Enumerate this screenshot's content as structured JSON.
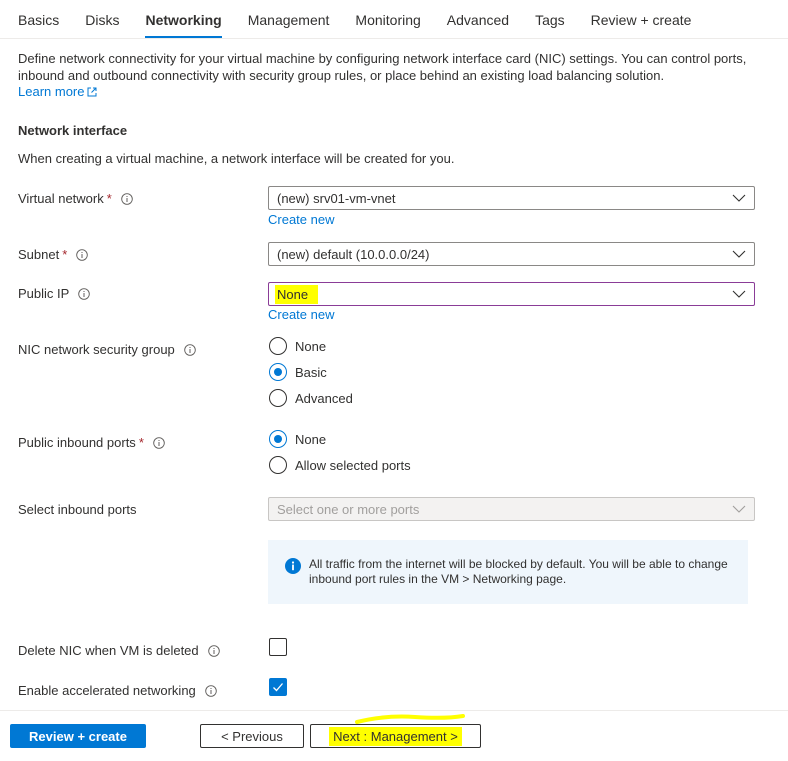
{
  "tabs": [
    {
      "label": "Basics"
    },
    {
      "label": "Disks"
    },
    {
      "label": "Networking",
      "active": true
    },
    {
      "label": "Management"
    },
    {
      "label": "Monitoring"
    },
    {
      "label": "Advanced"
    },
    {
      "label": "Tags"
    },
    {
      "label": "Review + create"
    }
  ],
  "description": {
    "text": "Define network connectivity for your virtual machine by configuring network interface card (NIC) settings. You can control ports, inbound and outbound connectivity with security group rules, or place behind an existing load balancing solution.",
    "learn_more": "Learn more"
  },
  "network_interface": {
    "title": "Network interface",
    "subtitle": "When creating a virtual machine, a network interface will be created for you."
  },
  "fields": {
    "virtual_network": {
      "label": "Virtual network",
      "required": "*",
      "value": "(new) srv01-vm-vnet",
      "create_new": "Create new"
    },
    "subnet": {
      "label": "Subnet",
      "required": "*",
      "value": "(new) default (10.0.0.0/24)"
    },
    "public_ip": {
      "label": "Public IP",
      "value": "None",
      "create_new": "Create new"
    },
    "nsg": {
      "label": "NIC network security group",
      "options": [
        "None",
        "Basic",
        "Advanced"
      ],
      "selected": "Basic"
    },
    "public_inbound_ports": {
      "label": "Public inbound ports",
      "required": "*",
      "options": [
        "None",
        "Allow selected ports"
      ],
      "selected": "None"
    },
    "select_inbound_ports": {
      "label": "Select inbound ports",
      "placeholder": "Select one or more ports"
    },
    "info_message": "All traffic from the internet will be blocked by default. You will be able to change inbound port rules in the VM > Networking page.",
    "delete_nic": {
      "label": "Delete NIC when VM is deleted",
      "checked": false
    },
    "accelerated_networking": {
      "label": "Enable accelerated networking",
      "checked": true
    }
  },
  "footer": {
    "review_create": "Review + create",
    "previous": "< Previous",
    "next": "Next : Management >"
  },
  "colors": {
    "accent": "#0078d4",
    "required": "#a4262c",
    "highlight": "#ffff00",
    "info_bg": "#eff6fc"
  }
}
